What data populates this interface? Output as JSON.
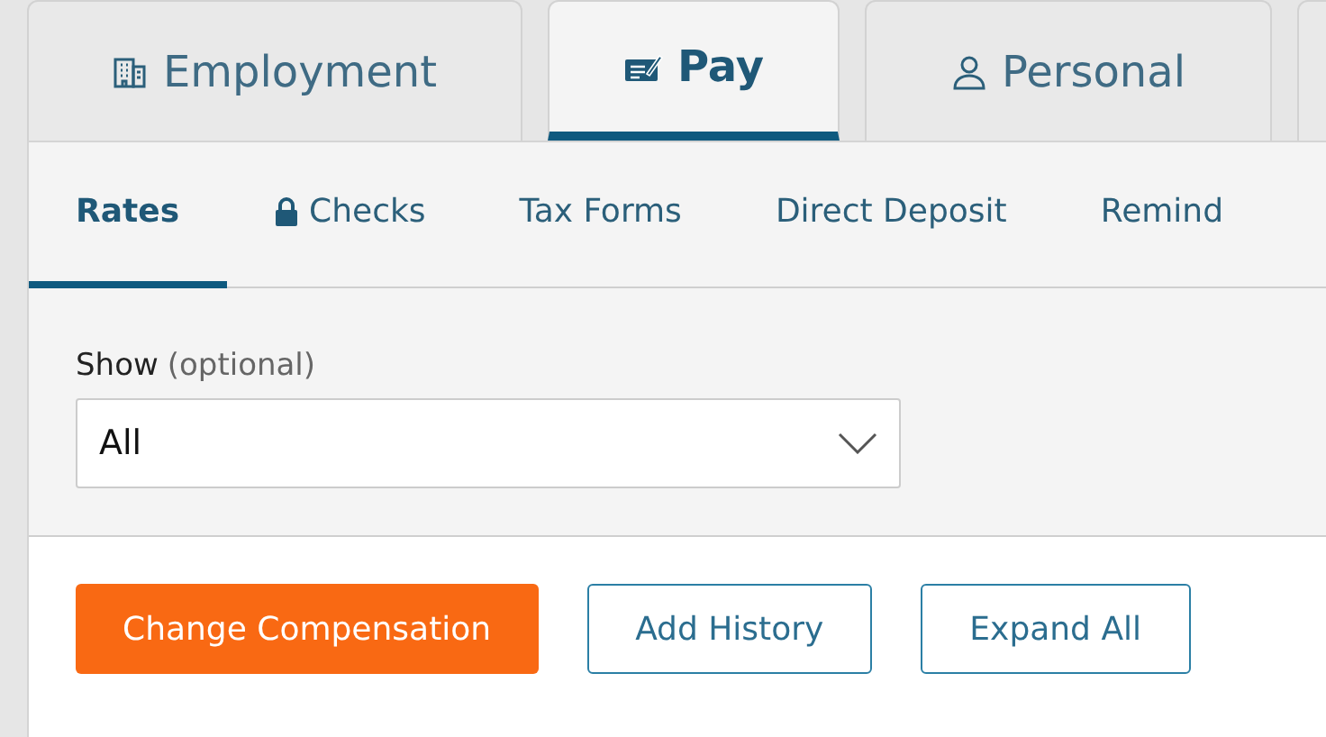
{
  "tabs": [
    {
      "label": "Employment",
      "kind": "building",
      "selected": false
    },
    {
      "label": "Pay",
      "kind": "cheque",
      "selected": true
    },
    {
      "label": "Personal",
      "kind": "person",
      "selected": false
    },
    {
      "kind": "blank",
      "selected": false
    }
  ],
  "subtabs": [
    {
      "label": "Rates",
      "locked": false,
      "selected": true
    },
    {
      "label": "Checks",
      "locked": true,
      "selected": false
    },
    {
      "label": "Tax Forms",
      "locked": false,
      "selected": false
    },
    {
      "label": "Direct Deposit",
      "locked": false,
      "selected": false
    },
    {
      "label": "Remind",
      "locked": false,
      "selected": false
    }
  ],
  "filter": {
    "label": "Show",
    "hint": "(optional)",
    "value": "All"
  },
  "buttons": [
    {
      "label": "Change Compensation",
      "kind": "primary"
    },
    {
      "label": "Add History",
      "kind": "outline"
    },
    {
      "label": "Expand All",
      "kind": "outline"
    }
  ]
}
